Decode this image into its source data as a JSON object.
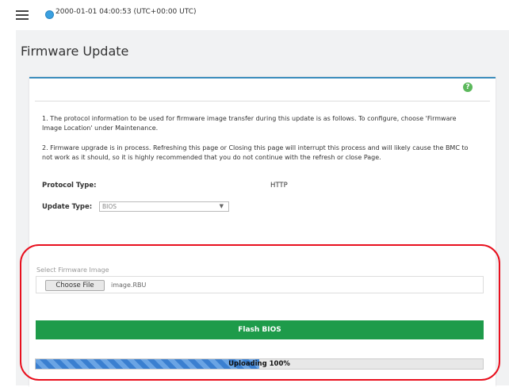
{
  "header": {
    "datetime": "2000-01-01 04:00:53 (UTC+00:00 UTC)"
  },
  "page": {
    "title": "Firmware Update"
  },
  "notes": {
    "note1": "1. The protocol information to be used for firmware image transfer during this update is as follows. To configure, choose 'Firmware Image Location' under Maintenance.",
    "note2": "2. Firmware upgrade is in process. Refreshing this page or Closing this page will interrupt this process and will likely cause the BMC to not work as it should, so it is highly recommended that you do not continue with the refresh or close Page."
  },
  "protocol": {
    "label": "Protocol Type:",
    "value": "HTTP"
  },
  "update_type": {
    "label": "Update Type:",
    "selected": "BIOS"
  },
  "firmware": {
    "label": "Select Firmware Image",
    "choose_label": "Choose File",
    "file_name": "image.RBU"
  },
  "flash": {
    "label": "Flash BIOS"
  },
  "progress": {
    "text": "Uploading 100%",
    "percent": 0.5
  },
  "colors": {
    "accent": "#3c8dbc",
    "flash_button": "#1e9b4a",
    "highlight": "#e8101e",
    "progress": "#3a7fd0"
  },
  "icons": {
    "menu": "hamburger-icon",
    "clock": "clock-icon",
    "help": "help-icon",
    "dropdown": "chevron-down-icon"
  }
}
